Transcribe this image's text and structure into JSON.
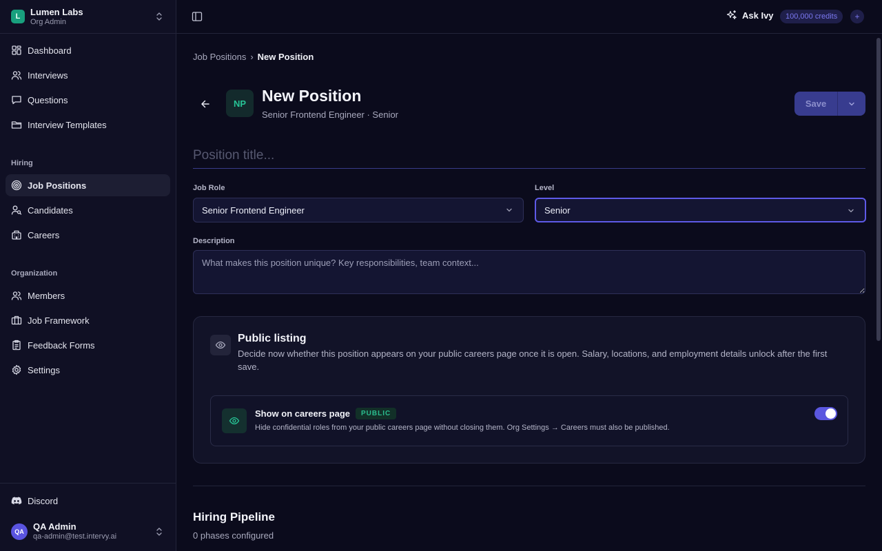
{
  "org": {
    "logo_letter": "L",
    "name": "Lumen Labs",
    "role": "Org Admin"
  },
  "sidebar": {
    "items": [
      {
        "label": "Dashboard",
        "icon": "dashboard-icon"
      },
      {
        "label": "Interviews",
        "icon": "users-icon"
      },
      {
        "label": "Questions",
        "icon": "message-icon"
      },
      {
        "label": "Interview Templates",
        "icon": "folder-icon"
      }
    ],
    "hiring_label": "Hiring",
    "hiring_items": [
      {
        "label": "Job Positions",
        "icon": "target-icon",
        "active": true
      },
      {
        "label": "Candidates",
        "icon": "user-search-icon"
      },
      {
        "label": "Careers",
        "icon": "building-icon"
      }
    ],
    "organization_label": "Organization",
    "organization_items": [
      {
        "label": "Members",
        "icon": "users-icon"
      },
      {
        "label": "Job Framework",
        "icon": "briefcase-icon"
      },
      {
        "label": "Feedback Forms",
        "icon": "clipboard-icon"
      },
      {
        "label": "Settings",
        "icon": "gear-icon"
      }
    ],
    "discord_label": "Discord",
    "user": {
      "initials": "QA",
      "name": "QA Admin",
      "email": "qa-admin@test.intervy.ai"
    }
  },
  "topbar": {
    "ask_label": "Ask Ivy",
    "credits": "100,000 credits",
    "credits_plus": "+"
  },
  "breadcrumb": {
    "parent": "Job Positions",
    "separator": "›",
    "current": "New Position"
  },
  "header": {
    "badge": "NP",
    "title": "New Position",
    "subtitle": "Senior Frontend Engineer · Senior",
    "save_label": "Save"
  },
  "form": {
    "title_placeholder": "Position title...",
    "job_role_label": "Job Role",
    "job_role_value": "Senior Frontend Engineer",
    "level_label": "Level",
    "level_value": "Senior",
    "description_label": "Description",
    "description_placeholder": "What makes this position unique? Key responsibilities, team context..."
  },
  "public_listing": {
    "title": "Public listing",
    "description": "Decide now whether this position appears on your public careers page once it is open. Salary, locations, and employment details unlock after the first save.",
    "toggle_title": "Show on careers page",
    "toggle_badge": "PUBLIC",
    "toggle_description": "Hide confidential roles from your public careers page without closing them. Org Settings → Careers must also be published.",
    "enabled": true
  },
  "pipeline": {
    "title": "Hiring Pipeline",
    "subtitle": "0 phases configured"
  },
  "colors": {
    "accent": "#5b57e0",
    "brand": "#19a07e",
    "background": "#0b0b1c",
    "sidebar": "#101024"
  }
}
